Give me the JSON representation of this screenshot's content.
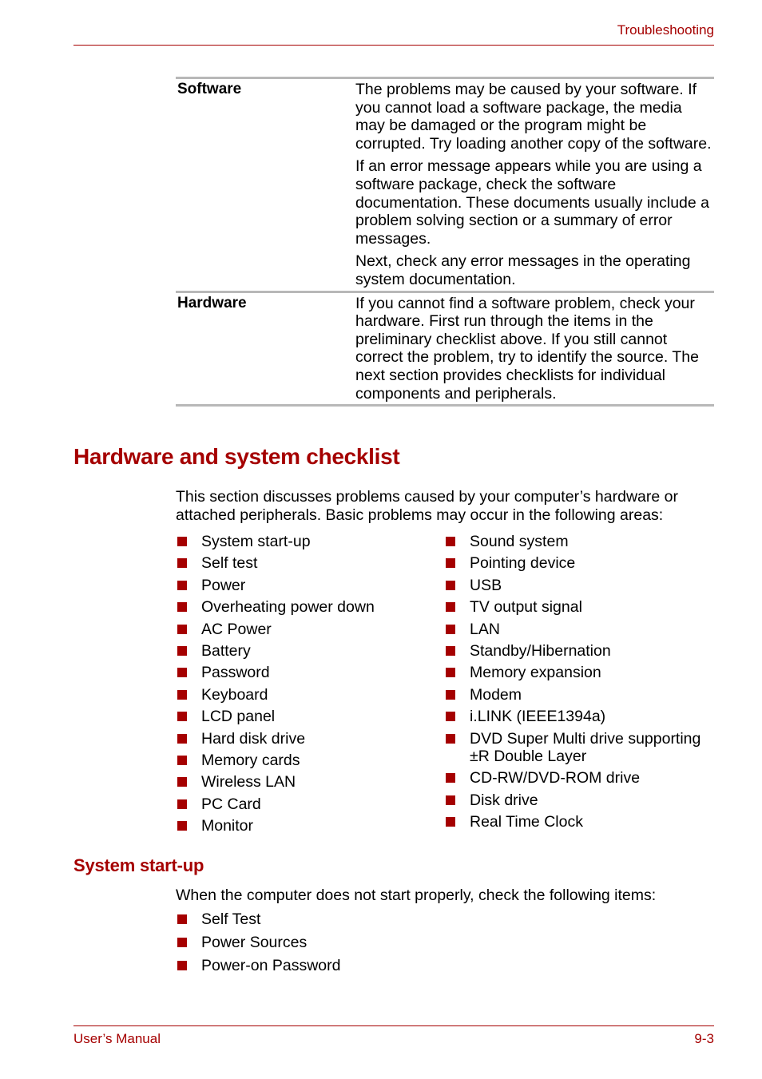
{
  "header": {
    "title": "Troubleshooting"
  },
  "table": {
    "rows": [
      {
        "label": "Software",
        "paragraphs": [
          "The problems may be caused by your software. If you cannot load a software package, the media may be damaged or the program might be corrupted. Try loading another copy of the software.",
          "If an error message appears while you are using a software package, check the software documentation. These documents usually include a problem solving section or a summary of error messages.",
          "Next, check any error messages in the operating system documentation."
        ]
      },
      {
        "label": "Hardware",
        "paragraphs": [
          "If you cannot find a software problem, check your hardware. First run through the items in the preliminary checklist above. If you still cannot correct the problem, try to identify the source. The next section provides checklists for individual components and peripherals."
        ]
      }
    ]
  },
  "section": {
    "title": "Hardware and system checklist",
    "intro": "This section discusses problems caused by your computer’s hardware or attached peripherals. Basic problems may occur in the following areas:",
    "left_items": [
      "System start-up",
      "Self test",
      "Power",
      "Overheating power down",
      "AC Power",
      "Battery",
      "Password",
      "Keyboard",
      "LCD panel",
      "Hard disk drive",
      "Memory cards",
      "Wireless LAN",
      "PC Card",
      "Monitor"
    ],
    "right_items": [
      "Sound system",
      "Pointing device",
      "USB",
      "TV output signal",
      "LAN",
      "Standby/Hibernation",
      "Memory expansion",
      "Modem",
      "i.LINK (IEEE1394a)",
      "DVD Super Multi drive supporting ±R Double Layer",
      "CD-RW/DVD-ROM drive",
      "Disk drive",
      "Real Time Clock"
    ]
  },
  "subsection": {
    "title": "System start-up",
    "intro": "When the computer does not start properly, check the following items:",
    "items": [
      "Self Test",
      "Power Sources",
      "Power-on Password"
    ]
  },
  "footer": {
    "left": "User’s Manual",
    "right": "9-3"
  },
  "colors": {
    "accent": "#a50000",
    "rule_gray": "#b8b8b8"
  }
}
